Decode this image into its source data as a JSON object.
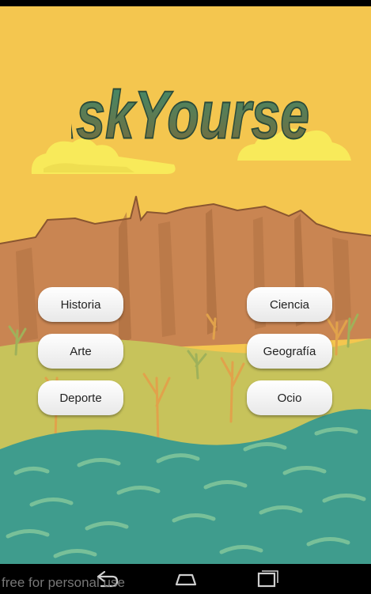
{
  "app": {
    "title": "AskYourself"
  },
  "categories": {
    "historia": "Historia",
    "ciencia": "Ciencia",
    "arte": "Arte",
    "geografia": "Geografía",
    "deporte": "Deporte",
    "ocio": "Ocio"
  },
  "watermark": "free for personal use",
  "colors": {
    "sky": "#f4c64f",
    "cloud": "#f8ea5a",
    "rock": "#c98552",
    "grass": "#c7c35b",
    "water": "#3f9c8d",
    "button": "#f2f2f2"
  },
  "nav": {
    "back": "back-icon",
    "home": "home-icon",
    "recents": "recents-icon"
  }
}
